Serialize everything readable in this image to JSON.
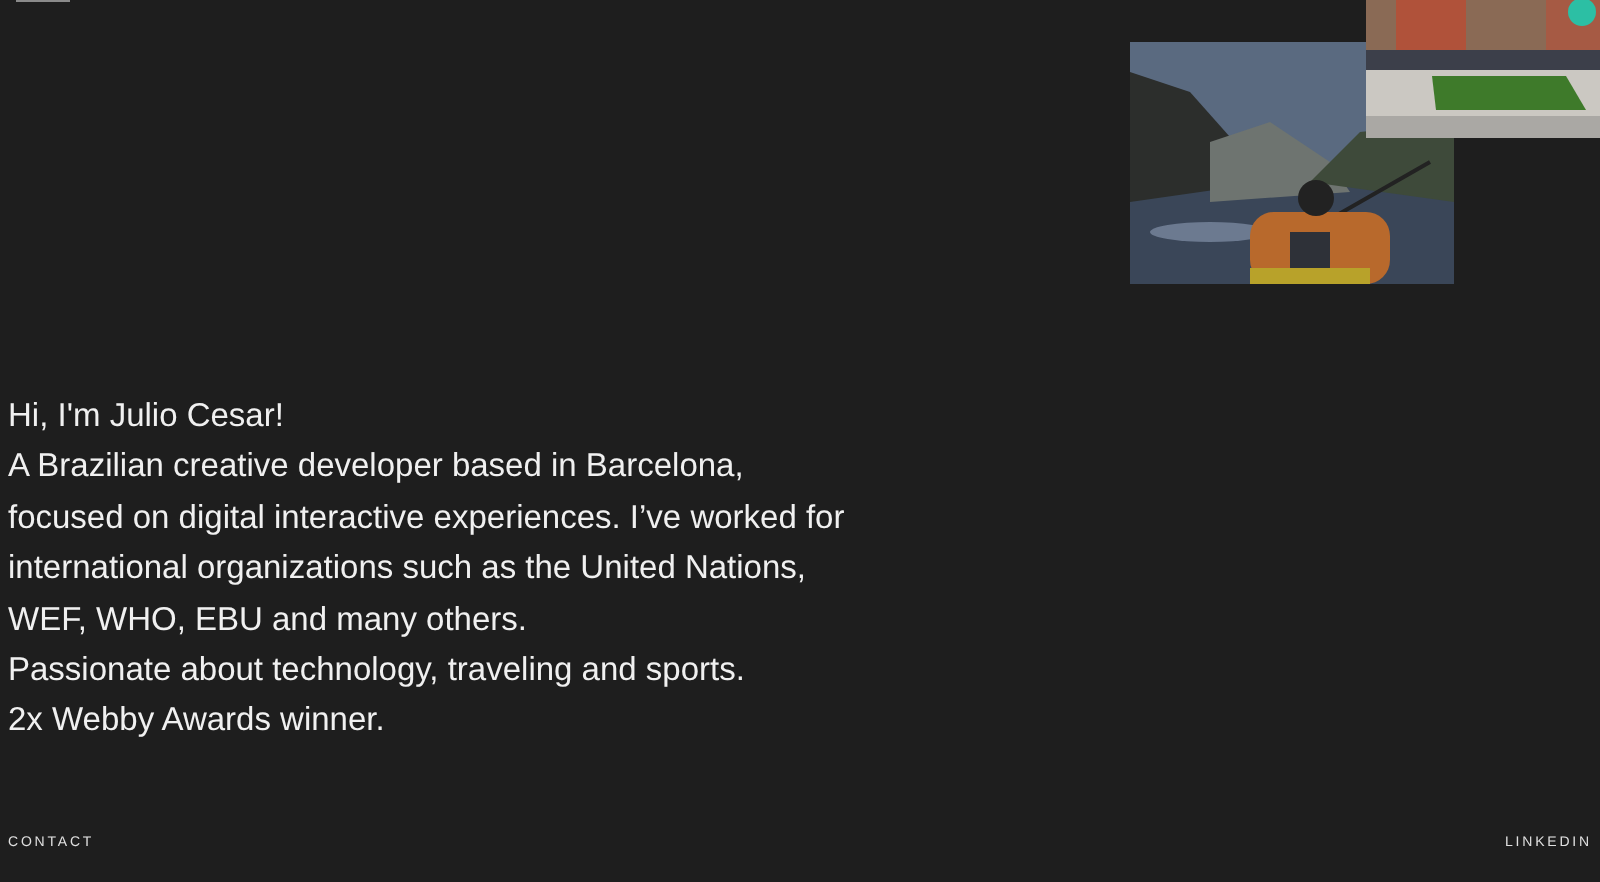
{
  "intro": {
    "lines": [
      "Hi, I'm Julio Cesar!",
      "A Brazilian creative developer based in Barcelona,",
      "focused on digital interactive experiences. I’ve worked for",
      "international organizations such as the United Nations,",
      "WEF, WHO, EBU and many others.",
      "Passionate about technology, traveling and sports.",
      "2x Webby Awards winner."
    ]
  },
  "footer": {
    "links": [
      "CONTACT",
      "LINKEDIN"
    ]
  }
}
